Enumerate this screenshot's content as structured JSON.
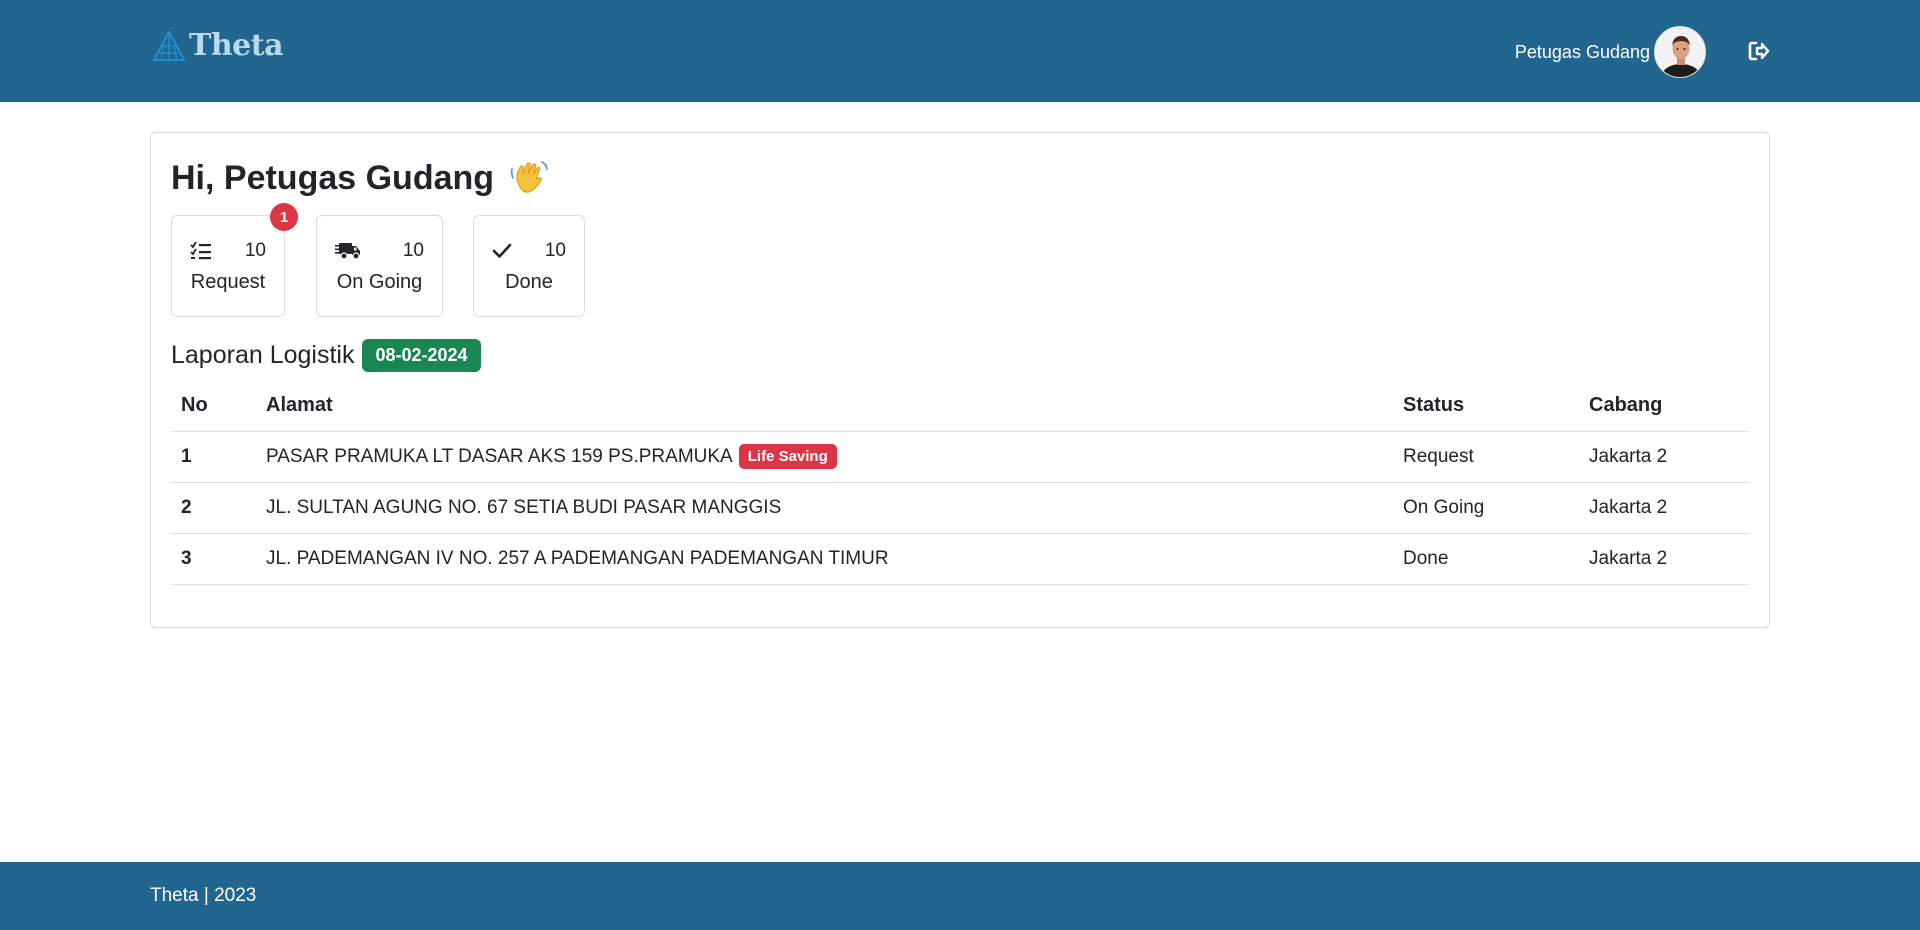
{
  "navbar": {
    "brand": "Theta",
    "user_name": "Petugas Gudang",
    "logout_icon": "logout-icon",
    "color": "#21668f"
  },
  "main": {
    "greeting": "Hi, Petugas Gudang",
    "stats": [
      {
        "icon": "checklist-icon",
        "count": "10",
        "label": "Request",
        "badge": "1"
      },
      {
        "icon": "truck-icon",
        "count": "10",
        "label": "On Going"
      },
      {
        "icon": "check-icon",
        "count": "10",
        "label": "Done"
      }
    ],
    "report": {
      "title": "Laporan Logistik",
      "date": "08-02-2024",
      "columns": [
        "No",
        "Alamat",
        "Status",
        "Cabang"
      ],
      "rows": [
        {
          "no": "1",
          "alamat": "PASAR PRAMUKA LT DASAR AKS 159 PS.PRAMUKA",
          "tag": "Life Saving",
          "status": "Request",
          "cabang": "Jakarta 2"
        },
        {
          "no": "2",
          "alamat": "JL. SULTAN AGUNG NO. 67 SETIA BUDI PASAR MANGGIS",
          "status": "On Going",
          "cabang": "Jakarta 2"
        },
        {
          "no": "3",
          "alamat": "JL. PADEMANGAN IV NO. 257 A PADEMANGAN PADEMANGAN TIMUR",
          "status": "Done",
          "cabang": "Jakarta 2"
        }
      ]
    }
  },
  "footer": {
    "text": "Theta | 2023"
  }
}
